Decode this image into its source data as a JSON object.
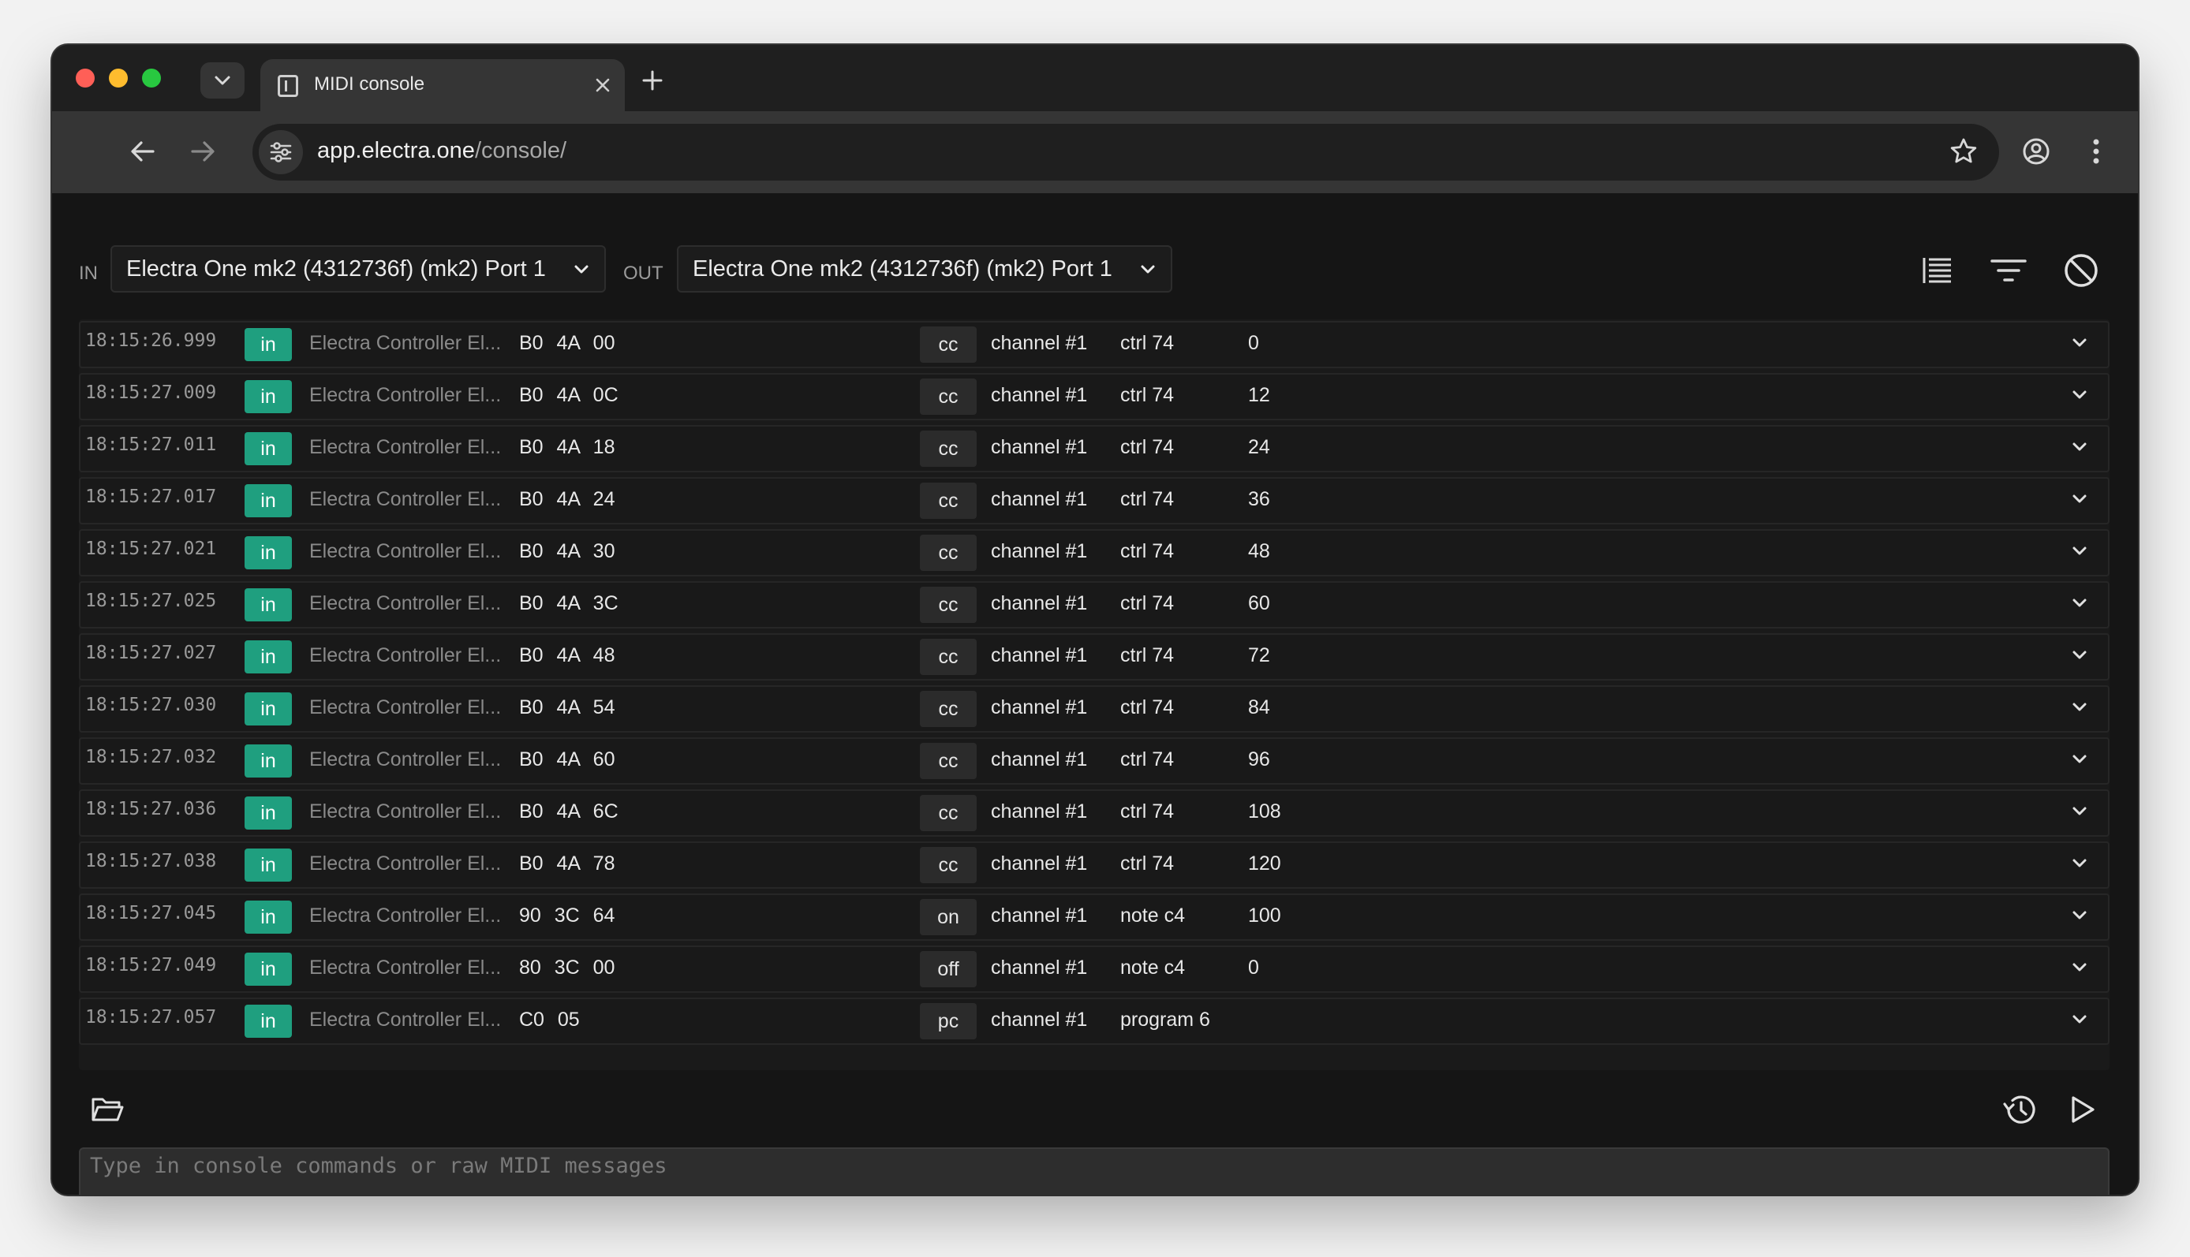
{
  "browser": {
    "tab_title": "MIDI console",
    "url_host": "app.electra.one",
    "url_path": "/console/"
  },
  "console": {
    "in_label": "IN",
    "out_label": "OUT",
    "in_port": "Electra One mk2 (4312736f) (mk2) Port 1",
    "out_port": "Electra One mk2 (4312736f) (mk2) Port 1",
    "command_placeholder": "Type in console commands or raw MIDI messages",
    "messages": [
      {
        "time": "18:15:26.999",
        "dir": "in",
        "device": "Electra Controller El...",
        "raw": "B0 4A 00",
        "type": "cc",
        "channel": "channel #1",
        "ctrl": "ctrl 74",
        "value": "0"
      },
      {
        "time": "18:15:27.009",
        "dir": "in",
        "device": "Electra Controller El...",
        "raw": "B0 4A 0C",
        "type": "cc",
        "channel": "channel #1",
        "ctrl": "ctrl 74",
        "value": "12"
      },
      {
        "time": "18:15:27.011",
        "dir": "in",
        "device": "Electra Controller El...",
        "raw": "B0 4A 18",
        "type": "cc",
        "channel": "channel #1",
        "ctrl": "ctrl 74",
        "value": "24"
      },
      {
        "time": "18:15:27.017",
        "dir": "in",
        "device": "Electra Controller El...",
        "raw": "B0 4A 24",
        "type": "cc",
        "channel": "channel #1",
        "ctrl": "ctrl 74",
        "value": "36"
      },
      {
        "time": "18:15:27.021",
        "dir": "in",
        "device": "Electra Controller El...",
        "raw": "B0 4A 30",
        "type": "cc",
        "channel": "channel #1",
        "ctrl": "ctrl 74",
        "value": "48"
      },
      {
        "time": "18:15:27.025",
        "dir": "in",
        "device": "Electra Controller El...",
        "raw": "B0 4A 3C",
        "type": "cc",
        "channel": "channel #1",
        "ctrl": "ctrl 74",
        "value": "60"
      },
      {
        "time": "18:15:27.027",
        "dir": "in",
        "device": "Electra Controller El...",
        "raw": "B0 4A 48",
        "type": "cc",
        "channel": "channel #1",
        "ctrl": "ctrl 74",
        "value": "72"
      },
      {
        "time": "18:15:27.030",
        "dir": "in",
        "device": "Electra Controller El...",
        "raw": "B0 4A 54",
        "type": "cc",
        "channel": "channel #1",
        "ctrl": "ctrl 74",
        "value": "84"
      },
      {
        "time": "18:15:27.032",
        "dir": "in",
        "device": "Electra Controller El...",
        "raw": "B0 4A 60",
        "type": "cc",
        "channel": "channel #1",
        "ctrl": "ctrl 74",
        "value": "96"
      },
      {
        "time": "18:15:27.036",
        "dir": "in",
        "device": "Electra Controller El...",
        "raw": "B0 4A 6C",
        "type": "cc",
        "channel": "channel #1",
        "ctrl": "ctrl 74",
        "value": "108"
      },
      {
        "time": "18:15:27.038",
        "dir": "in",
        "device": "Electra Controller El...",
        "raw": "B0 4A 78",
        "type": "cc",
        "channel": "channel #1",
        "ctrl": "ctrl 74",
        "value": "120"
      },
      {
        "time": "18:15:27.045",
        "dir": "in",
        "device": "Electra Controller El...",
        "raw": "90 3C 64",
        "type": "on",
        "channel": "channel #1",
        "ctrl": "note c4",
        "value": "100"
      },
      {
        "time": "18:15:27.049",
        "dir": "in",
        "device": "Electra Controller El...",
        "raw": "80 3C 00",
        "type": "off",
        "channel": "channel #1",
        "ctrl": "note c4",
        "value": "0"
      },
      {
        "time": "18:15:27.057",
        "dir": "in",
        "device": "Electra Controller El...",
        "raw": "C0 05",
        "type": "pc",
        "channel": "channel #1",
        "ctrl": "program 6",
        "value": ""
      }
    ]
  },
  "icons": {
    "toolbar": [
      "back-arrow-icon",
      "forward-arrow-icon",
      "reload-icon",
      "site-settings-icon",
      "bookmark-star-icon",
      "profile-icon",
      "more-vert-icon"
    ],
    "console_header": [
      "list-view-icon",
      "filter-icon",
      "clear-block-icon"
    ],
    "console_footer": [
      "open-folder-icon",
      "history-icon",
      "send-play-icon"
    ]
  },
  "colors": {
    "in_badge": "#1f9f7f",
    "background": "#151515"
  }
}
